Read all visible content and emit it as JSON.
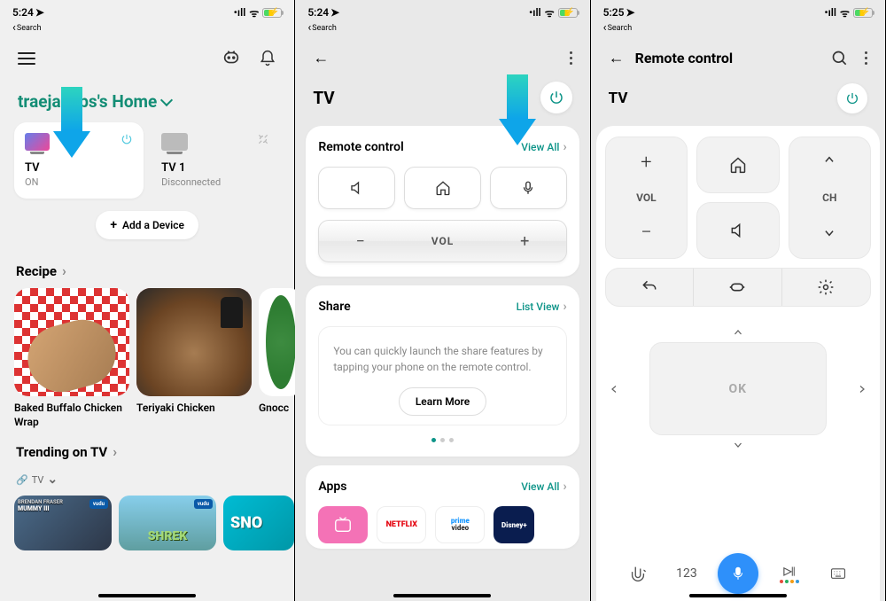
{
  "status": {
    "time1": "5:24",
    "time3": "5:25",
    "back": "Search"
  },
  "phone1": {
    "home_title": "traejacobs's Home",
    "devices": [
      {
        "name": "TV",
        "status": "ON"
      },
      {
        "name": "TV 1",
        "status": "Disconnected"
      }
    ],
    "add_device": "Add a Device",
    "recipe_head": "Recipe",
    "recipes": [
      "Baked Buffalo Chicken Wrap",
      "Teriyaki Chicken",
      "Gnocc"
    ],
    "trending": "Trending on TV",
    "trending_sub": "TV",
    "shows": {
      "s1a": "BRENDAN FRASER",
      "s1b": "MUMMY III",
      "vudu": "vudu",
      "shrek": "SHREK",
      "sno": "SNO"
    }
  },
  "phone2": {
    "page_title": "TV",
    "remote_head": "Remote control",
    "view_all": "View All",
    "vol": "VOL",
    "share_head": "Share",
    "list_view": "List View",
    "share_desc": "You can quickly launch the share features by tapping your phone on the remote control.",
    "learn": "Learn More",
    "apps_head": "Apps",
    "apps": {
      "netflix": "NETFLIX",
      "prime1": "prime",
      "prime2": "video",
      "disney": "Disney+"
    }
  },
  "phone3": {
    "title": "Remote control",
    "tv": "TV",
    "vol": "VOL",
    "ch": "CH",
    "ok": "OK",
    "num": "123"
  }
}
